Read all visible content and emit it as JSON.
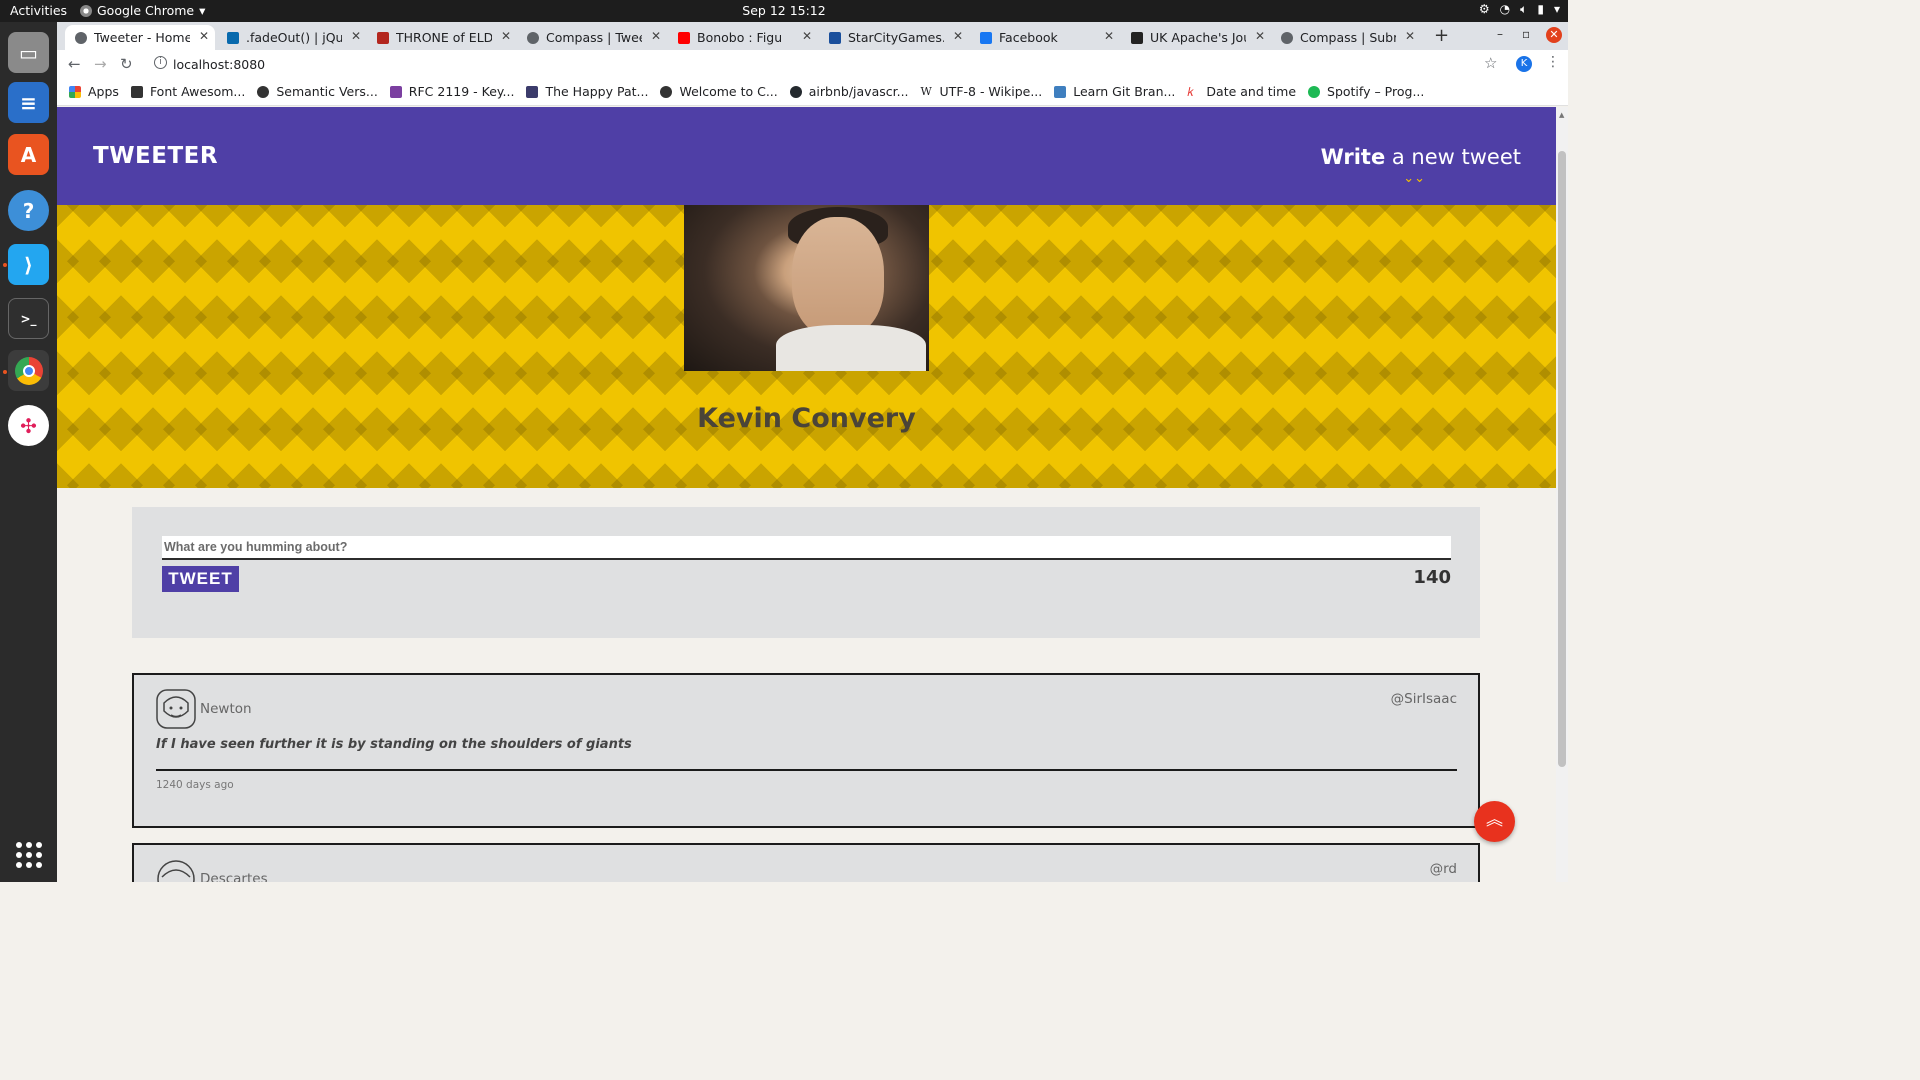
{
  "os": {
    "activities": "Activities",
    "app_name": "Google Chrome",
    "clock": "Sep 12  15:12"
  },
  "browser": {
    "tabs": [
      {
        "title": "Tweeter - Home Page",
        "favicon_color": "#5f6368"
      },
      {
        "title": ".fadeOut() | jQuery",
        "favicon_color": "#0769ad"
      },
      {
        "title": "THRONE of ELDRAINE",
        "favicon_color": "#b3261e"
      },
      {
        "title": "Compass | Tweeter",
        "favicon_color": "#5f6368"
      },
      {
        "title": "Bonobo : Figures",
        "favicon_color": "#ff0000"
      },
      {
        "title": "StarCityGames.com",
        "favicon_color": "#1a4f9c"
      },
      {
        "title": "Facebook",
        "favicon_color": "#1877f2"
      },
      {
        "title": "UK Apache's Journal",
        "favicon_color": "#222222"
      },
      {
        "title": "Compass | Submit",
        "favicon_color": "#5f6368"
      }
    ],
    "url": "localhost:8080",
    "profile_initial": "K",
    "bookmarks": [
      {
        "label": "Apps",
        "color": "#ea4335"
      },
      {
        "label": "Font Awesom...",
        "color": "#333333"
      },
      {
        "label": "Semantic Vers...",
        "color": "#333333"
      },
      {
        "label": "RFC 2119 - Key...",
        "color": "#7b3fa0"
      },
      {
        "label": "The Happy Pat...",
        "color": "#3b3b6b"
      },
      {
        "label": "Welcome to C...",
        "color": "#333333"
      },
      {
        "label": "airbnb/javascr...",
        "color": "#24292e"
      },
      {
        "label": "UTF-8 - Wikipe...",
        "color": "#000000"
      },
      {
        "label": "Learn Git Bran...",
        "color": "#3f7fbf"
      },
      {
        "label": "Date and time",
        "color": "#e53935"
      },
      {
        "label": "Spotify – Prog...",
        "color": "#1db954"
      }
    ]
  },
  "header": {
    "brand": "TWEETER",
    "compose_strong": "Write",
    "compose_rest": " a new tweet"
  },
  "profile": {
    "name": "Kevin Convery"
  },
  "composer": {
    "placeholder": "What are you humming about?",
    "button_label": "TWEET",
    "counter": "140"
  },
  "tweets": [
    {
      "name": "Newton",
      "handle": "@SirIsaac",
      "body": "If I have seen further it is by standing on the shoulders of giants",
      "time": "1240 days ago"
    },
    {
      "name": "Descartes",
      "handle": "@rd",
      "body": "",
      "time": ""
    }
  ]
}
